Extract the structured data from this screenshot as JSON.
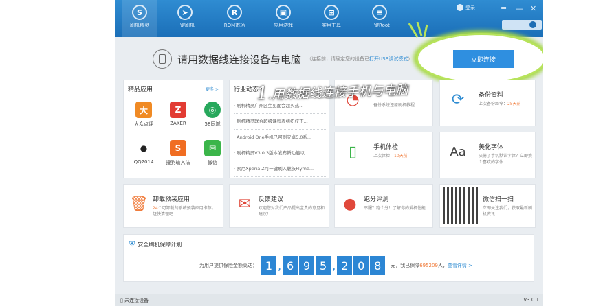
{
  "nav": [
    {
      "label": "刷机精灵",
      "icon": "shield-icon"
    },
    {
      "label": "一键刷机",
      "icon": "cursor-icon"
    },
    {
      "label": "ROM市场",
      "icon": "r-icon"
    },
    {
      "label": "应用游戏",
      "icon": "apps-icon"
    },
    {
      "label": "实用工具",
      "icon": "tools-icon"
    },
    {
      "label": "一键Root",
      "icon": "root-icon"
    }
  ],
  "topbar": {
    "login_label": "登录"
  },
  "connect": {
    "title": "请用数据线连接设备与电脑",
    "hint": "（连接前，请确定您的设备已",
    "hint_link": "打开USB调试模式",
    "hint_end": "）",
    "button": "立即连接"
  },
  "annotation": {
    "num": "1",
    "text": ".用数据线连接手机与电脑"
  },
  "featured": {
    "title": "精品应用",
    "more": "更多 >",
    "apps": [
      {
        "label": "大众点评",
        "color": "#f08a24",
        "glyph": "大"
      },
      {
        "label": "ZAKER",
        "color": "#e23b33",
        "glyph": "Z"
      },
      {
        "label": "58同城",
        "color": "#27a85c",
        "glyph": "◎"
      },
      {
        "label": "QQ2014",
        "color": "#ffffff",
        "glyph": "🐧"
      },
      {
        "label": "搜狗输入法",
        "color": "#f06d22",
        "glyph": "S"
      },
      {
        "label": "微信",
        "color": "#3bb54a",
        "glyph": "✉"
      }
    ]
  },
  "news": {
    "title": "行业动态",
    "items": [
      "· 刷机精灵广州区生见面会超火热...",
      "· 刷机精灵联合超级课程表组织校下...",
      "· Android One手机已可刷安卓5.0系...",
      "· 刷机精灵V3.0.3版本发布新功能以...",
      "· 索尼Xperia Z可一键刷入魅族Flyme..."
    ]
  },
  "tiles": {
    "backup_hint": {
      "desc": "备份系统还原刷机教程"
    },
    "backup": {
      "title": "备份资料",
      "desc_a": "上次备份距今：",
      "desc_b": "25天前"
    },
    "check": {
      "title": "手机体检",
      "desc_a": "上次体检：",
      "desc_b": "10天前"
    },
    "font": {
      "title": "美化字体",
      "desc": "厌倦了手机默认字体？立即换个喜欢的字体"
    },
    "uninstall": {
      "title": "卸载预装应用",
      "desc_a": "24",
      "desc_b": "个可卸载的系统预装应用推荐，赶快清理吧"
    },
    "feedback": {
      "title": "反馈建议",
      "desc": "欢迎您对我们产品提出宝贵的意见和建议！"
    },
    "bench": {
      "title": "跑分评测",
      "desc": "不服？跑个分！了解你的爱机性能"
    },
    "wechat": {
      "title": "微信扫一扫",
      "desc": "立即关注我们，获取最新刷机资讯"
    }
  },
  "protect": {
    "title": "安全刷机保障计划",
    "prefix": "为用户提供保险金额高达：",
    "digits": [
      "1",
      "6",
      "9",
      "5",
      "2",
      "0",
      "8"
    ],
    "suffix_a": "元，我已保障",
    "suffix_count": "695209",
    "suffix_b": "人，",
    "link": "查看详情 >"
  },
  "status": {
    "left": "未连接设备",
    "right": "V3.0.1"
  }
}
